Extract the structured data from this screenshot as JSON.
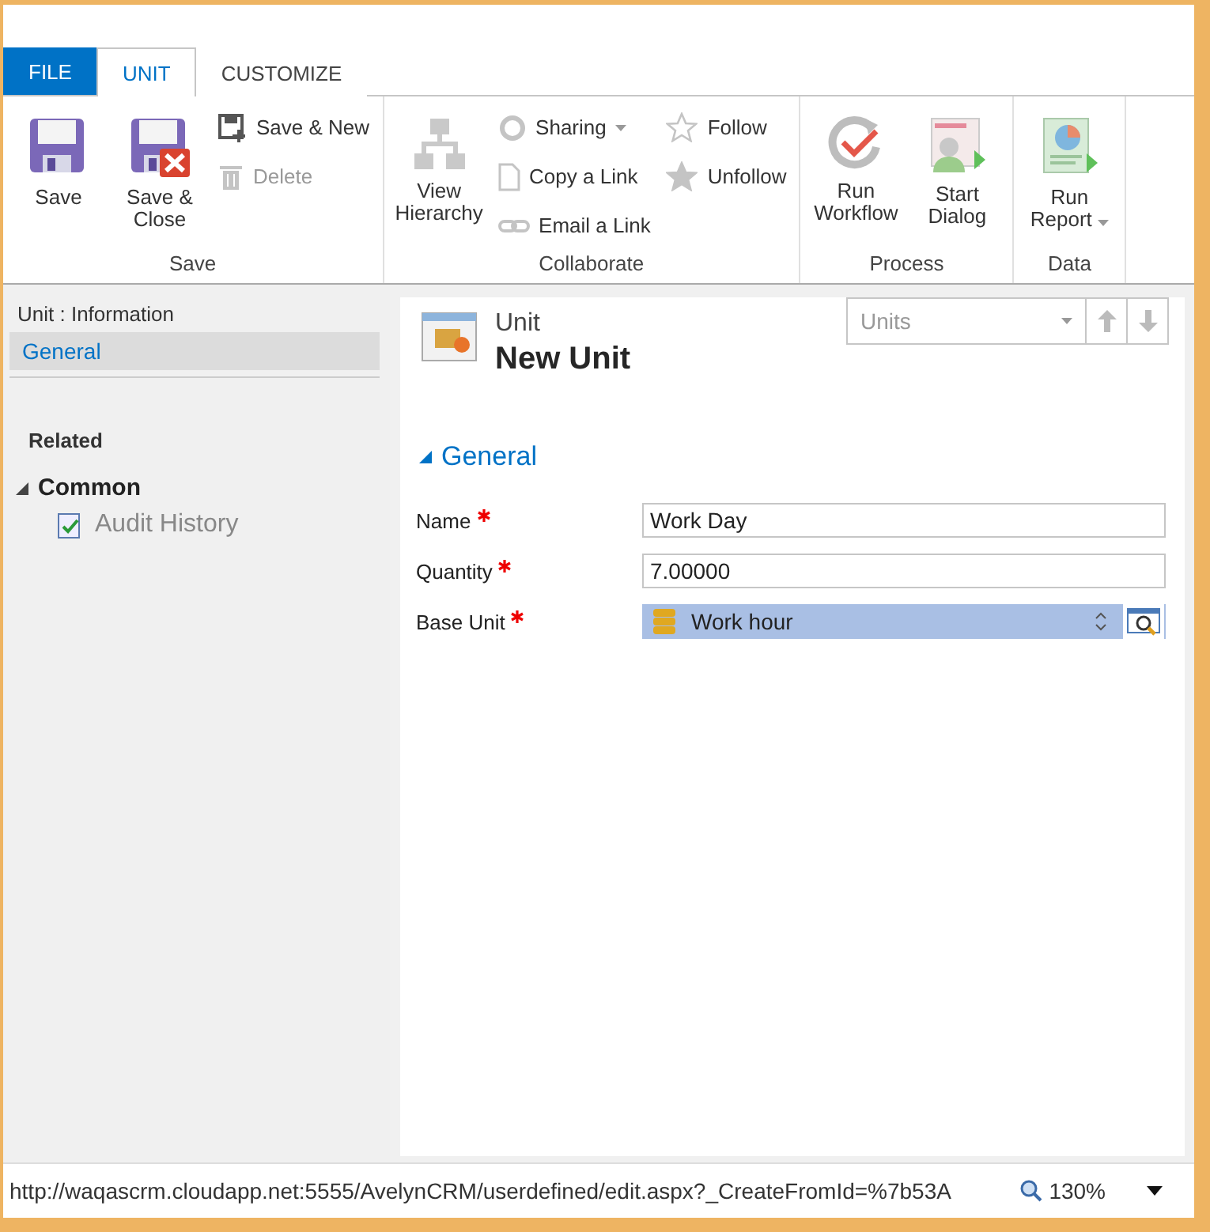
{
  "tabs": [
    {
      "label": "FILE",
      "kind": "file",
      "selected": false
    },
    {
      "label": "UNIT",
      "kind": "tab",
      "selected": true
    },
    {
      "label": "CUSTOMIZE",
      "kind": "tab",
      "selected": false
    }
  ],
  "ribbon": [
    {
      "name": "Save",
      "buttons": [
        {
          "label": "Save",
          "kind": "large",
          "disabled": false
        },
        {
          "label": "Save & Close",
          "kind": "large",
          "disabled": false
        },
        {
          "label": "Save & New",
          "kind": "small",
          "disabled": false
        },
        {
          "label": "Delete",
          "kind": "small",
          "disabled": true
        }
      ]
    },
    {
      "name": "Collaborate",
      "buttons": [
        {
          "label": "View Hierarchy",
          "kind": "large",
          "disabled": false
        },
        {
          "label": "Sharing",
          "kind": "small",
          "disabled": false,
          "dropdown": true
        },
        {
          "label": "Copy a Link",
          "kind": "small",
          "disabled": false
        },
        {
          "label": "Email a Link",
          "kind": "small",
          "disabled": false
        },
        {
          "label": "Follow",
          "kind": "small",
          "disabled": false
        },
        {
          "label": "Unfollow",
          "kind": "small",
          "disabled": false
        }
      ]
    },
    {
      "name": "Process",
      "buttons": [
        {
          "label": "Run Workflow",
          "kind": "large",
          "disabled": false
        },
        {
          "label": "Start Dialog",
          "kind": "large",
          "disabled": false
        }
      ]
    },
    {
      "name": "Data",
      "buttons": [
        {
          "label": "Run Report",
          "kind": "large",
          "disabled": false,
          "dropdown": true
        }
      ]
    }
  ],
  "nav": {
    "title": "Unit : Information",
    "items": [
      {
        "label": "General",
        "selected": true
      }
    ],
    "related": "Related",
    "groups": [
      {
        "label": "Common",
        "expanded": true,
        "items": [
          "Audit History"
        ]
      }
    ]
  },
  "form": {
    "entity": "Unit",
    "title": "New Unit",
    "record_picker": {
      "value": "Units"
    },
    "section": "General",
    "fields": [
      {
        "label": "Name",
        "required": true,
        "kind": "text",
        "value": "Work Day",
        "selected": false
      },
      {
        "label": "Quantity",
        "required": true,
        "kind": "text",
        "value": "7.00000",
        "selected": false
      },
      {
        "label": "Base Unit",
        "required": true,
        "kind": "lookup",
        "value": "Work hour",
        "selected": true
      }
    ]
  },
  "status_bar": {
    "url": "http://waqascrm.cloudapp.net:5555/AvelynCRM/userdefined/edit.aspx?_CreateFromId=%7b53A",
    "zoom": "130%"
  }
}
